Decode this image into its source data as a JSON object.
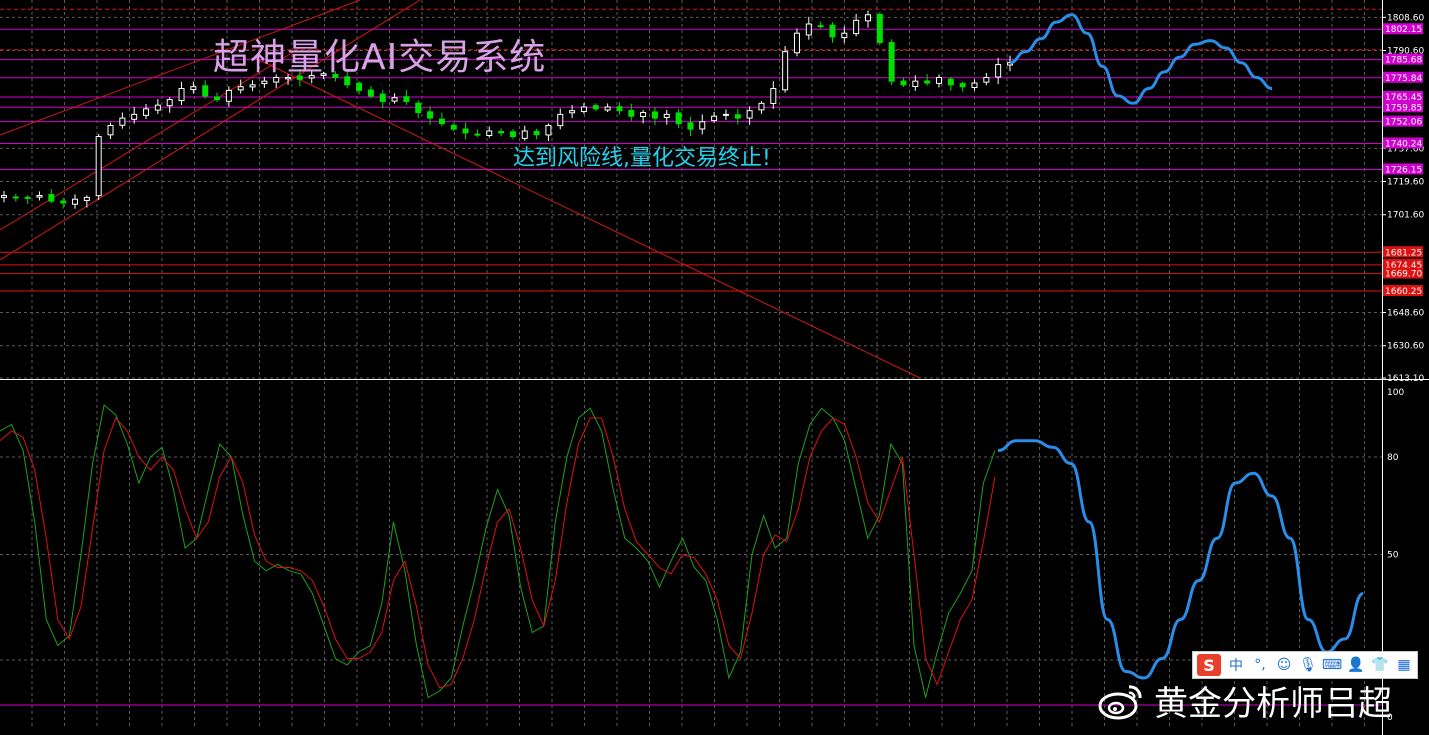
{
  "overlays": {
    "title": "超神量化AI交易系统",
    "risk_note": "达到风险线,量化交易终止!",
    "watermark": "黄金分析师吕超",
    "ime_logo": "S",
    "ime_char": "中"
  },
  "colors": {
    "background": "#000000",
    "bull_candle": "#ffffff",
    "bear_candle": "#00e000",
    "grid": "#5a5a5a",
    "trendline": "#d01818",
    "magenta_level": "#d000d0",
    "red_level": "#e01010",
    "forecast": "#2a8ee8",
    "stoch_main": "#1fa01f",
    "stoch_signal": "#e01010"
  },
  "chart_data": [
    {
      "type": "candlestick",
      "name": "price",
      "y_ticks": [
        "1808.60",
        "1790.60",
        "1737.60",
        "1719.60",
        "1701.60",
        "1648.60",
        "1630.60",
        "1613.10"
      ],
      "ylim": [
        1613.1,
        1818
      ],
      "magenta_levels": [
        {
          "value": 1802.15,
          "label": "1802.15"
        },
        {
          "value": 1785.68,
          "label": "1785.68"
        },
        {
          "value": 1775.84,
          "label": "1775.84"
        },
        {
          "value": 1765.45,
          "label": "1765.45"
        },
        {
          "value": 1759.85,
          "label": "1759.85"
        },
        {
          "value": 1752.06,
          "label": "1752.06"
        },
        {
          "value": 1740.24,
          "label": "1740.24"
        },
        {
          "value": 1726.15,
          "label": "1726.15"
        }
      ],
      "red_levels": [
        {
          "value": 1681.25,
          "label": "1681.25"
        },
        {
          "value": 1674.45,
          "label": "1674.45"
        },
        {
          "value": 1669.7,
          "label": "1669.70"
        },
        {
          "value": 1660.25,
          "label": "1660.25"
        }
      ],
      "close_path": [
        1712,
        1711,
        1711,
        1712,
        1709,
        1708,
        1710,
        1711,
        1744,
        1750,
        1754,
        1756,
        1759,
        1761,
        1764,
        1770,
        1771,
        1766,
        1764,
        1769,
        1771,
        1772,
        1774,
        1776,
        1776,
        1775,
        1777,
        1778,
        1776,
        1772,
        1769,
        1766,
        1763,
        1765,
        1763,
        1757,
        1754,
        1751,
        1748,
        1746,
        1745,
        1747,
        1746,
        1744,
        1747,
        1745,
        1750,
        1756,
        1758,
        1760,
        1759,
        1760,
        1758,
        1755,
        1757,
        1754,
        1756,
        1751,
        1748,
        1752,
        1755,
        1756,
        1754,
        1758,
        1762,
        1770,
        1790,
        1800,
        1805,
        1804,
        1798,
        1800,
        1807,
        1810,
        1795,
        1774,
        1772,
        1774,
        1773,
        1776,
        1772,
        1771,
        1773,
        1776,
        1783,
        1784
      ],
      "forecast_path": [
        1784,
        1790,
        1797,
        1806,
        1810,
        1800,
        1782,
        1766,
        1762,
        1770,
        1779,
        1787,
        1794,
        1796,
        1792,
        1784,
        1776,
        1770
      ]
    },
    {
      "type": "line",
      "name": "stochastic oscillator",
      "y_ticks": [
        "100",
        "80",
        "50",
        "0"
      ],
      "ylim": [
        0,
        100
      ],
      "series": [
        {
          "values": [
            88,
            90,
            82,
            60,
            30,
            22,
            25,
            50,
            78,
            96,
            93,
            84,
            72,
            80,
            83,
            70,
            52,
            55,
            70,
            84,
            80,
            62,
            48,
            45,
            47,
            45,
            44,
            38,
            28,
            18,
            16,
            20,
            22,
            35,
            60,
            45,
            22,
            6,
            8,
            12,
            28,
            42,
            58,
            70,
            62,
            40,
            26,
            28,
            60,
            80,
            92,
            95,
            88,
            70,
            55,
            52,
            48,
            40,
            48,
            55,
            46,
            42,
            30,
            12,
            20,
            50,
            62,
            52,
            55,
            78,
            90,
            95,
            92,
            85,
            70,
            55,
            62,
            84,
            78,
            22,
            6,
            20,
            32,
            38,
            45,
            72,
            82
          ]
        },
        {
          "values": [
            85,
            88,
            86,
            76,
            55,
            30,
            24,
            34,
            58,
            82,
            92,
            88,
            80,
            76,
            80,
            76,
            64,
            55,
            60,
            74,
            80,
            72,
            56,
            48,
            46,
            46,
            45,
            42,
            34,
            24,
            18,
            18,
            20,
            26,
            42,
            48,
            34,
            16,
            9,
            10,
            18,
            30,
            46,
            60,
            64,
            52,
            36,
            28,
            42,
            66,
            84,
            92,
            92,
            80,
            64,
            54,
            50,
            46,
            44,
            50,
            49,
            44,
            36,
            22,
            18,
            32,
            50,
            56,
            54,
            64,
            80,
            88,
            92,
            90,
            80,
            66,
            60,
            70,
            80,
            50,
            18,
            10,
            20,
            30,
            36,
            54,
            74
          ]
        }
      ],
      "forecast_path": [
        82,
        85,
        85,
        83,
        78,
        60,
        30,
        14,
        12,
        18,
        30,
        42,
        55,
        72,
        75,
        68,
        55,
        30,
        20,
        24,
        38
      ]
    }
  ]
}
